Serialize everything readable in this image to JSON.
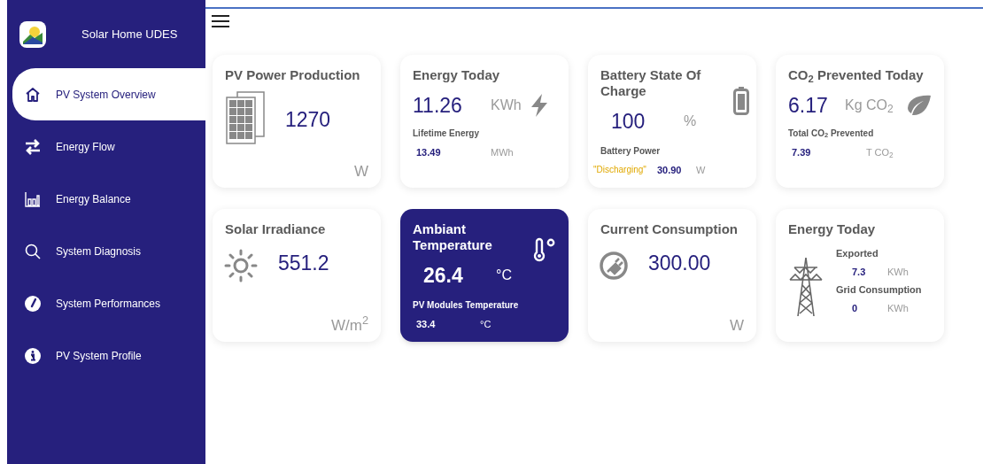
{
  "sidebar": {
    "app_title": "Solar Home UDES",
    "items": [
      {
        "label": "PV System Overview",
        "kind": "home",
        "selected": true
      },
      {
        "label": "Energy Flow",
        "kind": "exchange",
        "selected": false
      },
      {
        "label": "Energy Balance",
        "kind": "bars",
        "selected": false
      },
      {
        "label": "System Diagnosis",
        "kind": "search",
        "selected": false
      },
      {
        "label": "System Performances",
        "kind": "gauge",
        "selected": false
      },
      {
        "label": "PV System Profile",
        "kind": "info",
        "selected": false
      }
    ]
  },
  "cards": [
    {
      "kind": "power",
      "title": "PV Power Production",
      "value": "1270",
      "unit": "W"
    },
    {
      "kind": "energy",
      "title": "Energy Today",
      "value": "11.26",
      "unit": "KWh",
      "detail_label": "Lifetime Energy",
      "detail_value": "13.49",
      "detail_unit": "MWh"
    },
    {
      "kind": "battery",
      "title": "Battery State Of Charge",
      "value": "100",
      "unit": "%",
      "detail_label": "Battery Power",
      "status": "\"Discharging\"",
      "detail_value": "30.90",
      "detail_unit": "W"
    },
    {
      "kind": "co2",
      "title": "CO$_{2}$ Prevented Today",
      "value": "6.17",
      "unit": "Kg CO$_{2}$",
      "detail_label": "Total CO$_{2}$ Prevented",
      "detail_value": "7.39",
      "detail_unit": "T CO$_{2}$"
    },
    {
      "kind": "irradiance",
      "title": "Solar Irradiance",
      "value": "551.2",
      "unit": "W/m$^{2}$"
    },
    {
      "kind": "temperature",
      "title": "Ambiant Temperature",
      "value": "26.4",
      "unit": "°C",
      "detail_label": "PV Modules Temperature",
      "detail_value": "33.4",
      "detail_unit": "°C"
    },
    {
      "kind": "consumption",
      "title": "Current Consumption",
      "value": "300.00",
      "unit": "W"
    },
    {
      "kind": "grid",
      "title": "Energy Today",
      "rows": [
        {
          "label": "Exported",
          "value": "7.3",
          "unit": "KWh"
        },
        {
          "label": "Grid Consumption",
          "value": "0",
          "unit": "KWh"
        }
      ]
    }
  ]
}
